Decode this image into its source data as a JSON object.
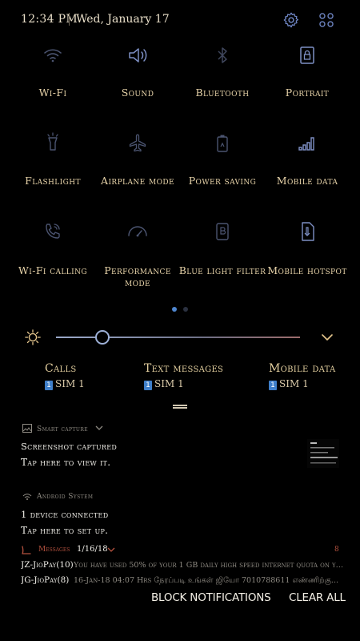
{
  "status": {
    "time": "12:34 PM",
    "date": "Wed, January 17"
  },
  "quick_settings": [
    {
      "label": "Wi-Fi",
      "icon": "wifi-icon"
    },
    {
      "label": "Sound",
      "icon": "speaker-icon"
    },
    {
      "label": "Bluetooth",
      "icon": "bluetooth-icon"
    },
    {
      "label": "Portrait",
      "icon": "rotation-lock-icon"
    },
    {
      "label": "Flashlight",
      "icon": "flashlight-icon"
    },
    {
      "label": "Airplane mode",
      "icon": "airplane-icon"
    },
    {
      "label": "Power saving",
      "icon": "battery-icon"
    },
    {
      "label": "Mobile data",
      "icon": "signal-bars-icon"
    },
    {
      "label": "Wi-Fi calling",
      "icon": "wifi-calling-icon"
    },
    {
      "label": "Performance mode",
      "icon": "speedometer-icon"
    },
    {
      "label": "Blue light filter",
      "icon": "blue-light-filter-icon"
    },
    {
      "label": "Mobile hotspot",
      "icon": "hotspot-icon"
    }
  ],
  "brightness": {
    "level": 0.19
  },
  "sim": {
    "calls": {
      "title": "Calls",
      "badge": "1",
      "sim": "SIM 1"
    },
    "text": {
      "title": "Text messages",
      "badge": "1",
      "sim": "SIM 1"
    },
    "data": {
      "title": "Mobile data",
      "badge": "1",
      "sim": "SIM 1"
    }
  },
  "notifications": {
    "smart_capture": {
      "app": "Smart capture",
      "title": "Screenshot captured",
      "text": "Tap here to view it."
    },
    "android_system": {
      "app": "Android System",
      "title": "1 device connected",
      "text": "Tap here to set up."
    },
    "messages": {
      "app": "Messages",
      "date": "1/16/18",
      "count": "8",
      "items": [
        {
          "sender": "JZ-JioPay(10)",
          "body": "You have used 50% of your 1 GB daily high speed internet quota on you..."
        },
        {
          "sender": "JG-JioPay(8)",
          "body": "16-Jan-18 04:07 Hrs நேரப்படி உங்கள் ஜியோ 7010788611 எண்ணிற்கு..."
        }
      ]
    }
  },
  "actions": {
    "block": "BLOCK NOTIFICATIONS",
    "clear": "CLEAR ALL"
  },
  "colors": {
    "accent": "#3f7fc9",
    "tile_icon": "#6f7fa8",
    "label": "#e6d2a8"
  }
}
